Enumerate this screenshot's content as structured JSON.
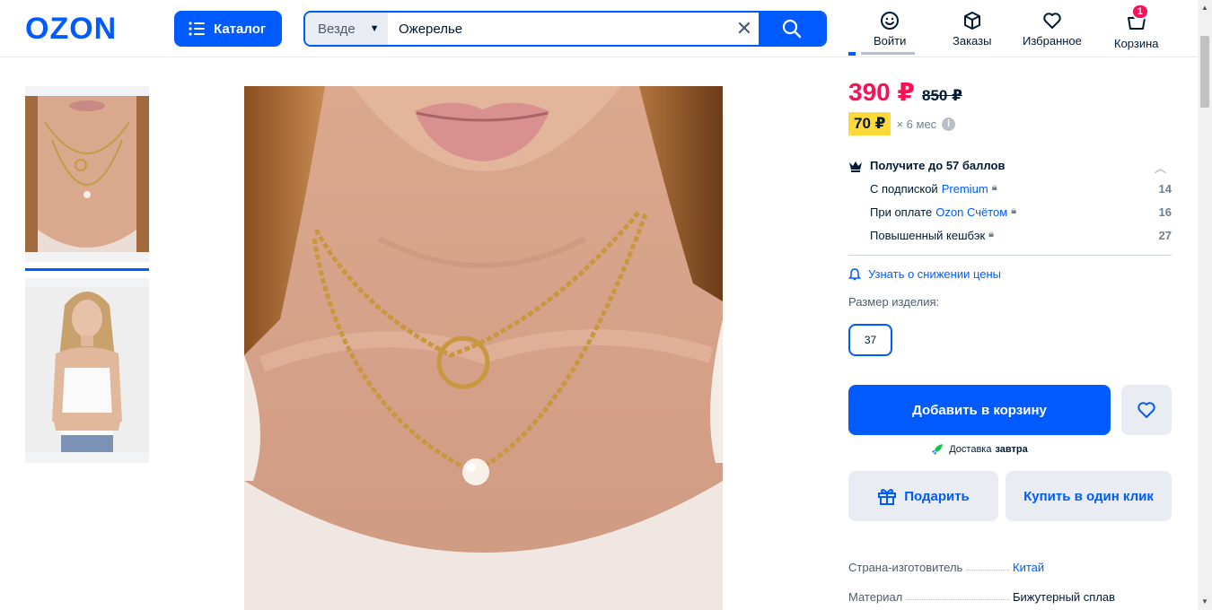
{
  "header": {
    "logo": "OZON",
    "catalog_label": "Каталог",
    "search_scope": "Везде",
    "search_value": "Ожерелье",
    "nav": {
      "login": "Войти",
      "orders": "Заказы",
      "favorites": "Избранное",
      "cart": "Корзина",
      "cart_count": "1"
    }
  },
  "product": {
    "price": "390 ₽",
    "old_price": "850 ₽",
    "installment_price": "70 ₽",
    "installment_term": "× 6 мес",
    "bonus": {
      "title": "Получите до 57 баллов",
      "rows": [
        {
          "prefix": "С подпиской ",
          "link": "Premium",
          "value": "14"
        },
        {
          "prefix": "При оплате ",
          "link": "Ozon Счётом",
          "value": "16"
        },
        {
          "prefix": "Повышенный кешбэк",
          "link": "",
          "value": "27"
        }
      ]
    },
    "price_alert": "Узнать о снижении цены",
    "size_label": "Размер изделия:",
    "size_value": "37",
    "add_to_cart": "Добавить в корзину",
    "delivery_prefix": "Доставка",
    "delivery_day": "завтра",
    "gift_label": "Подарить",
    "one_click_label": "Купить в один клик",
    "specs": [
      {
        "key": "Страна-изготовитель",
        "value": "Китай",
        "is_link": true
      },
      {
        "key": "Материал",
        "value": "Бижутерный сплав",
        "is_link": false
      }
    ]
  },
  "colors": {
    "brand": "#005bff",
    "price": "#f91155",
    "installment": "#ffd839"
  }
}
